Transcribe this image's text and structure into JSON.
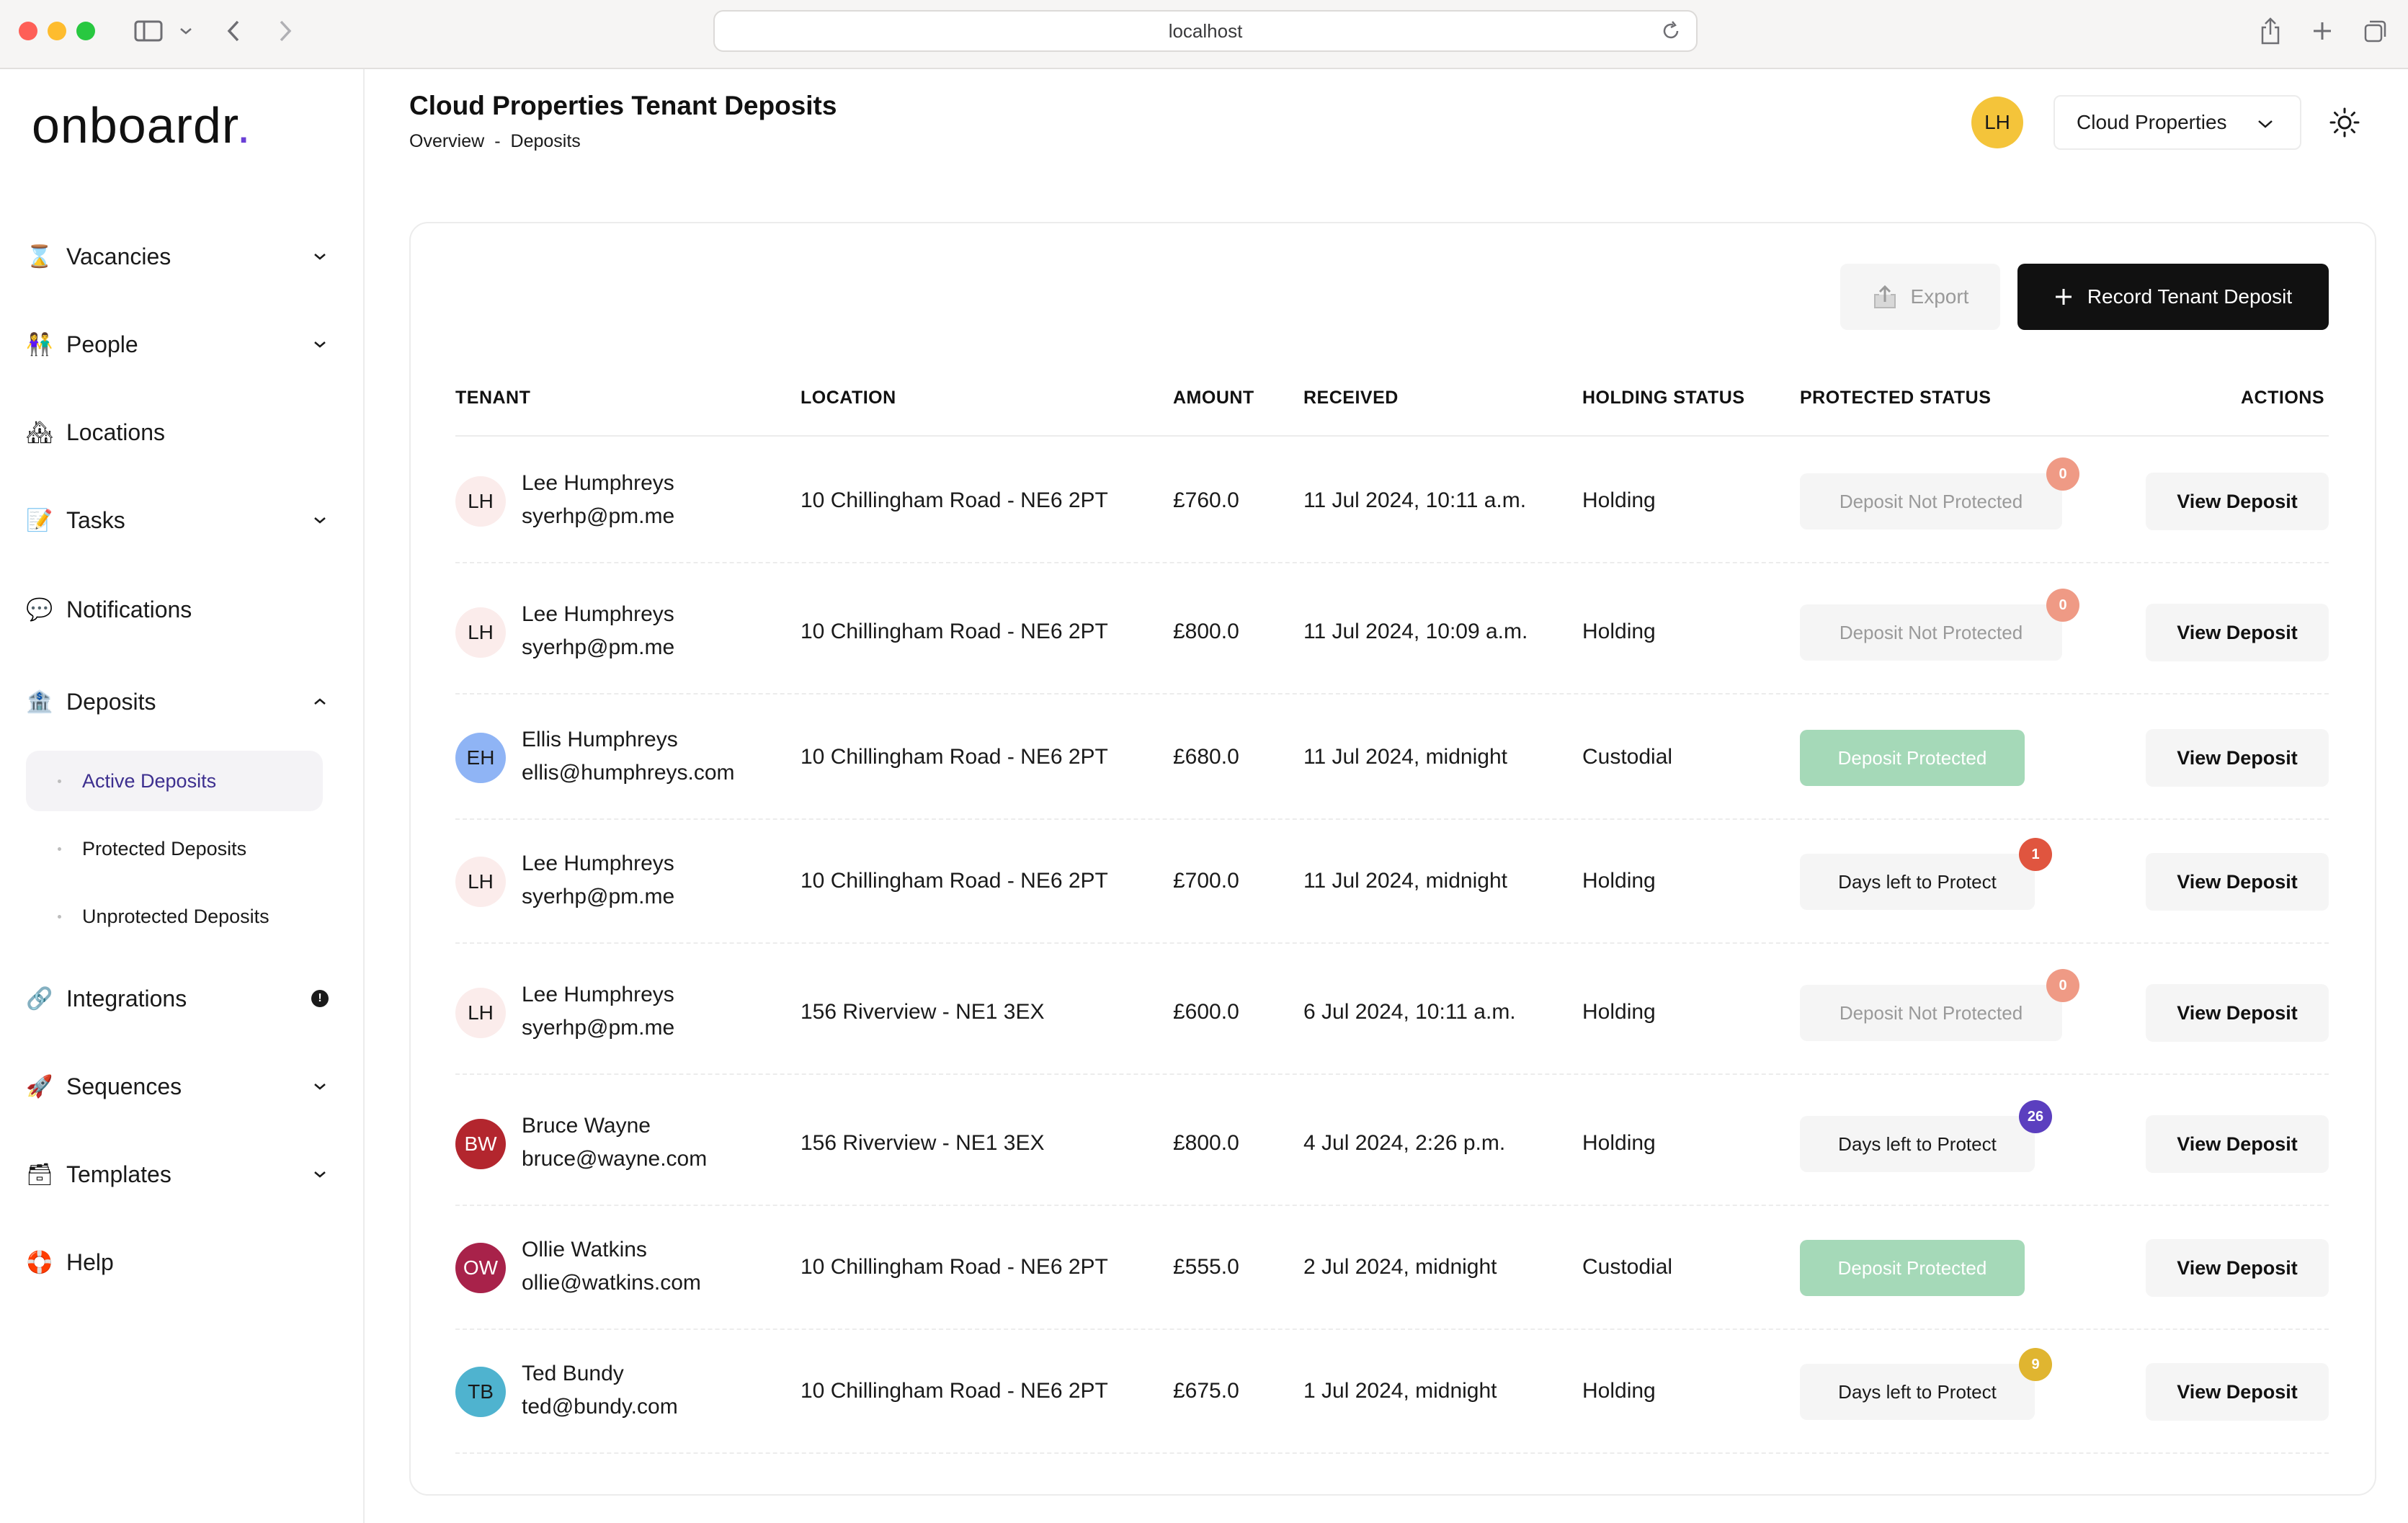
{
  "browser": {
    "url": "localhost"
  },
  "app": {
    "logo": "onboardr",
    "logo_dot": "."
  },
  "sidebar": {
    "items": [
      {
        "label": "Vacancies",
        "emoji": "⌛",
        "chevron": "down"
      },
      {
        "label": "People",
        "emoji": "👫",
        "chevron": "down"
      },
      {
        "label": "Locations",
        "emoji": "🏘",
        "chevron": ""
      },
      {
        "label": "Tasks",
        "emoji": "📝",
        "chevron": "down"
      },
      {
        "label": "Notifications",
        "emoji": "💬",
        "chevron": ""
      },
      {
        "label": "Deposits",
        "emoji": "🏦",
        "chevron": "up"
      },
      {
        "label": "Integrations",
        "emoji": "🔗",
        "chevron": "",
        "badge": "!"
      },
      {
        "label": "Sequences",
        "emoji": "🚀",
        "chevron": "down"
      },
      {
        "label": "Templates",
        "emoji": "🗃",
        "chevron": "down"
      },
      {
        "label": "Help",
        "emoji": "🛟",
        "chevron": ""
      }
    ],
    "deposit_subitems": [
      {
        "label": "Active Deposits",
        "active": true
      },
      {
        "label": "Protected Deposits",
        "active": false
      },
      {
        "label": "Unprotected Deposits",
        "active": false
      }
    ]
  },
  "header": {
    "title": "Cloud Properties Tenant Deposits",
    "breadcrumb": [
      "Overview",
      "-",
      "Deposits"
    ],
    "user_initials": "LH",
    "org_name": "Cloud Properties"
  },
  "toolbar": {
    "export_label": "Export",
    "record_label": "Record Tenant Deposit"
  },
  "table": {
    "columns": [
      "TENANT",
      "LOCATION",
      "AMOUNT",
      "RECEIVED",
      "HOLDING STATUS",
      "PROTECTED STATUS",
      "ACTIONS"
    ],
    "rows": [
      {
        "initials": "LH",
        "name": "Lee Humphreys",
        "email": "syerhp@pm.me",
        "location": "10 Chillingham Road - NE6 2PT",
        "amount": "£760.0",
        "received": "11 Jul 2024, 10:11 a.m.",
        "holding": "Holding",
        "protected": "Deposit Not Protected",
        "status_kind": "notprot",
        "count": "0",
        "count_color": "#ef9a85",
        "avatar_bg": "#fbeceb",
        "avatar_fg": "#1a1a1a",
        "action": "View Deposit"
      },
      {
        "initials": "LH",
        "name": "Lee Humphreys",
        "email": "syerhp@pm.me",
        "location": "10 Chillingham Road - NE6 2PT",
        "amount": "£800.0",
        "received": "11 Jul 2024, 10:09 a.m.",
        "holding": "Holding",
        "protected": "Deposit Not Protected",
        "status_kind": "notprot",
        "count": "0",
        "count_color": "#ef9a85",
        "avatar_bg": "#fbeceb",
        "avatar_fg": "#1a1a1a",
        "action": "View Deposit"
      },
      {
        "initials": "EH",
        "name": "Ellis Humphreys",
        "email": "ellis@humphreys.com",
        "location": "10 Chillingham Road - NE6 2PT",
        "amount": "£680.0",
        "received": "11 Jul 2024, midnight",
        "holding": "Custodial",
        "protected": "Deposit Protected",
        "status_kind": "prot",
        "count": "",
        "count_color": "",
        "avatar_bg": "#8fb4f5",
        "avatar_fg": "#1a1a1a",
        "action": "View Deposit"
      },
      {
        "initials": "LH",
        "name": "Lee Humphreys",
        "email": "syerhp@pm.me",
        "location": "10 Chillingham Road - NE6 2PT",
        "amount": "£700.0",
        "received": "11 Jul 2024, midnight",
        "holding": "Holding",
        "protected": "Days left to Protect",
        "status_kind": "days",
        "count": "1",
        "count_color": "#e0553f",
        "avatar_bg": "#fbeceb",
        "avatar_fg": "#1a1a1a",
        "action": "View Deposit"
      },
      {
        "initials": "LH",
        "name": "Lee Humphreys",
        "email": "syerhp@pm.me",
        "location": "156 Riverview - NE1 3EX",
        "amount": "£600.0",
        "received": "6 Jul 2024, 10:11 a.m.",
        "holding": "Holding",
        "protected": "Deposit Not Protected",
        "status_kind": "notprot",
        "count": "0",
        "count_color": "#ef9a85",
        "avatar_bg": "#fbeceb",
        "avatar_fg": "#1a1a1a",
        "action": "View Deposit"
      },
      {
        "initials": "BW",
        "name": "Bruce Wayne",
        "email": "bruce@wayne.com",
        "location": "156 Riverview - NE1 3EX",
        "amount": "£800.0",
        "received": "4 Jul 2024, 2:26 p.m.",
        "holding": "Holding",
        "protected": "Days left to Protect",
        "status_kind": "days",
        "count": "26",
        "count_color": "#5b3fbf",
        "avatar_bg": "#b3262e",
        "avatar_fg": "#ffffff",
        "action": "View Deposit"
      },
      {
        "initials": "OW",
        "name": "Ollie Watkins",
        "email": "ollie@watkins.com",
        "location": "10 Chillingham Road - NE6 2PT",
        "amount": "£555.0",
        "received": "2 Jul 2024, midnight",
        "holding": "Custodial",
        "protected": "Deposit Protected",
        "status_kind": "prot",
        "count": "",
        "count_color": "",
        "avatar_bg": "#a8224a",
        "avatar_fg": "#ffffff",
        "action": "View Deposit"
      },
      {
        "initials": "TB",
        "name": "Ted Bundy",
        "email": "ted@bundy.com",
        "location": "10 Chillingham Road - NE6 2PT",
        "amount": "£675.0",
        "received": "1 Jul 2024, midnight",
        "holding": "Holding",
        "protected": "Days left to Protect",
        "status_kind": "days",
        "count": "9",
        "count_color": "#e0b530",
        "avatar_bg": "#4fb3cf",
        "avatar_fg": "#1a1a1a",
        "action": "View Deposit"
      }
    ]
  },
  "colors": {
    "accent": "#6a3fd6",
    "primary_button": "#111111",
    "protected_pill": "#a5d9b8"
  }
}
